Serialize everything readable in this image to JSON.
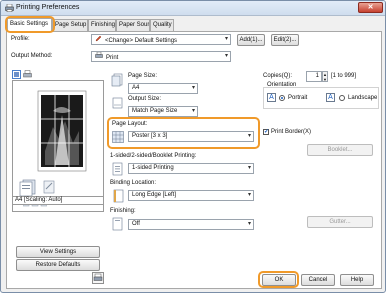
{
  "window": {
    "title": "Printing Preferences",
    "close_glyph": "✕"
  },
  "tabs": [
    {
      "label": "Basic Settings",
      "active": true
    },
    {
      "label": "Page Setup",
      "active": false
    },
    {
      "label": "Finishing",
      "active": false
    },
    {
      "label": "Paper Source",
      "active": false
    },
    {
      "label": "Quality",
      "active": false
    }
  ],
  "profile": {
    "label": "Profile:",
    "value": "<Change> Default Settings",
    "add_button": "Add(1)...",
    "edit_button": "Edit(2)..."
  },
  "output_method": {
    "label": "Output Method:",
    "value": "Print"
  },
  "left": {
    "scaling_label": "A4 [Scaling: Auto]",
    "view_settings": "View Settings",
    "restore_defaults": "Restore Defaults"
  },
  "page_size": {
    "label": "Page Size:",
    "value": "A4"
  },
  "output_size": {
    "label": "Output Size:",
    "value": "Match Page Size"
  },
  "copies": {
    "label": "Copies(Q):",
    "value": "1",
    "range": "[1 to 999]"
  },
  "orientation": {
    "label": "Orientation",
    "portrait": "Portrait",
    "landscape": "Landscape",
    "selected": "Portrait"
  },
  "page_layout": {
    "label": "Page Layout:",
    "value": "Poster [3 x 3]",
    "print_border": "Print Border(X)",
    "print_border_checked": true,
    "booklet_button": "Booklet..."
  },
  "duplex": {
    "label": "1-sided/2-sided/Booklet Printing:",
    "value": "1-sided Printing"
  },
  "binding": {
    "label": "Binding Location:",
    "value": "Long Edge [Left]",
    "gutter_button": "Gutter..."
  },
  "finishing": {
    "label": "Finishing:",
    "value": "Off"
  },
  "footer": {
    "ok": "OK",
    "cancel": "Cancel",
    "help": "Help"
  },
  "colors": {
    "accent_highlight": "#f09a2a",
    "radio_on": "#1d5fbf",
    "close_red": "#c6402f"
  },
  "icons": [
    "printer-icon",
    "pencil-icon",
    "poster-layout-icon",
    "document-stack-icon",
    "binding-icon",
    "finishing-icon",
    "portrait-icon",
    "landscape-icon"
  ]
}
